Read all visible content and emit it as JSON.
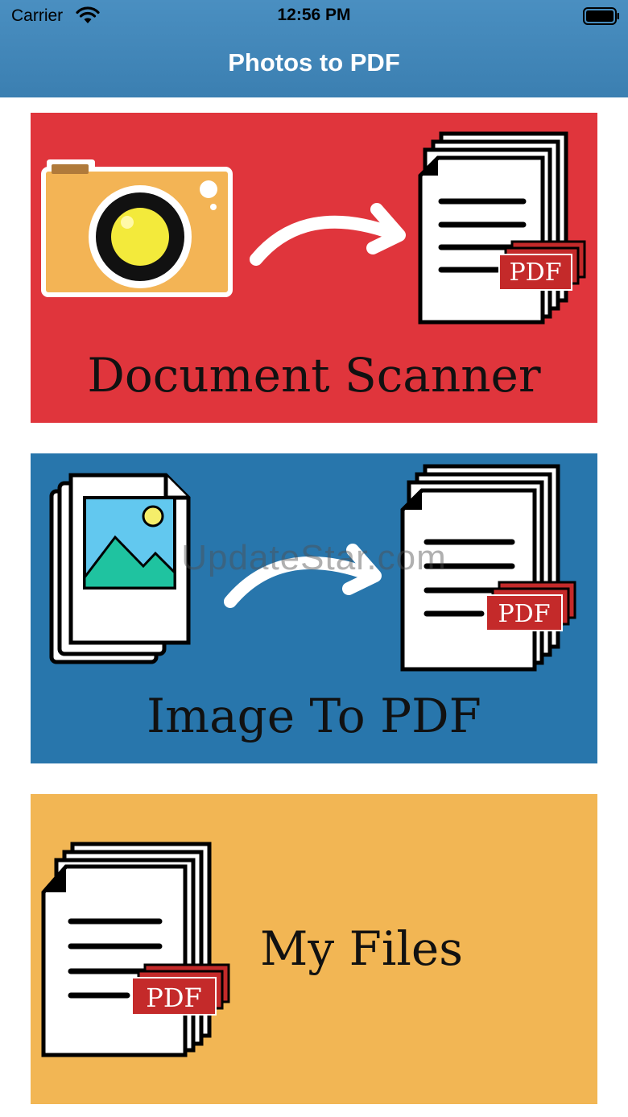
{
  "status_bar": {
    "carrier": "Carrier",
    "time": "12:56 PM"
  },
  "nav": {
    "title": "Photos to PDF"
  },
  "cards": {
    "scanner": {
      "label": "Document Scanner",
      "color": "#e0353c"
    },
    "image_to_pdf": {
      "label": "Image To PDF",
      "color": "#2876ac"
    },
    "my_files": {
      "label": "My Files",
      "color": "#f2b654"
    }
  },
  "icons": {
    "pdf_badge": "PDF",
    "names": [
      "wifi-icon",
      "battery-icon",
      "camera-icon",
      "arrow-icon",
      "pdf-document-icon",
      "image-document-icon"
    ]
  },
  "watermark": "UpdateStar.com"
}
